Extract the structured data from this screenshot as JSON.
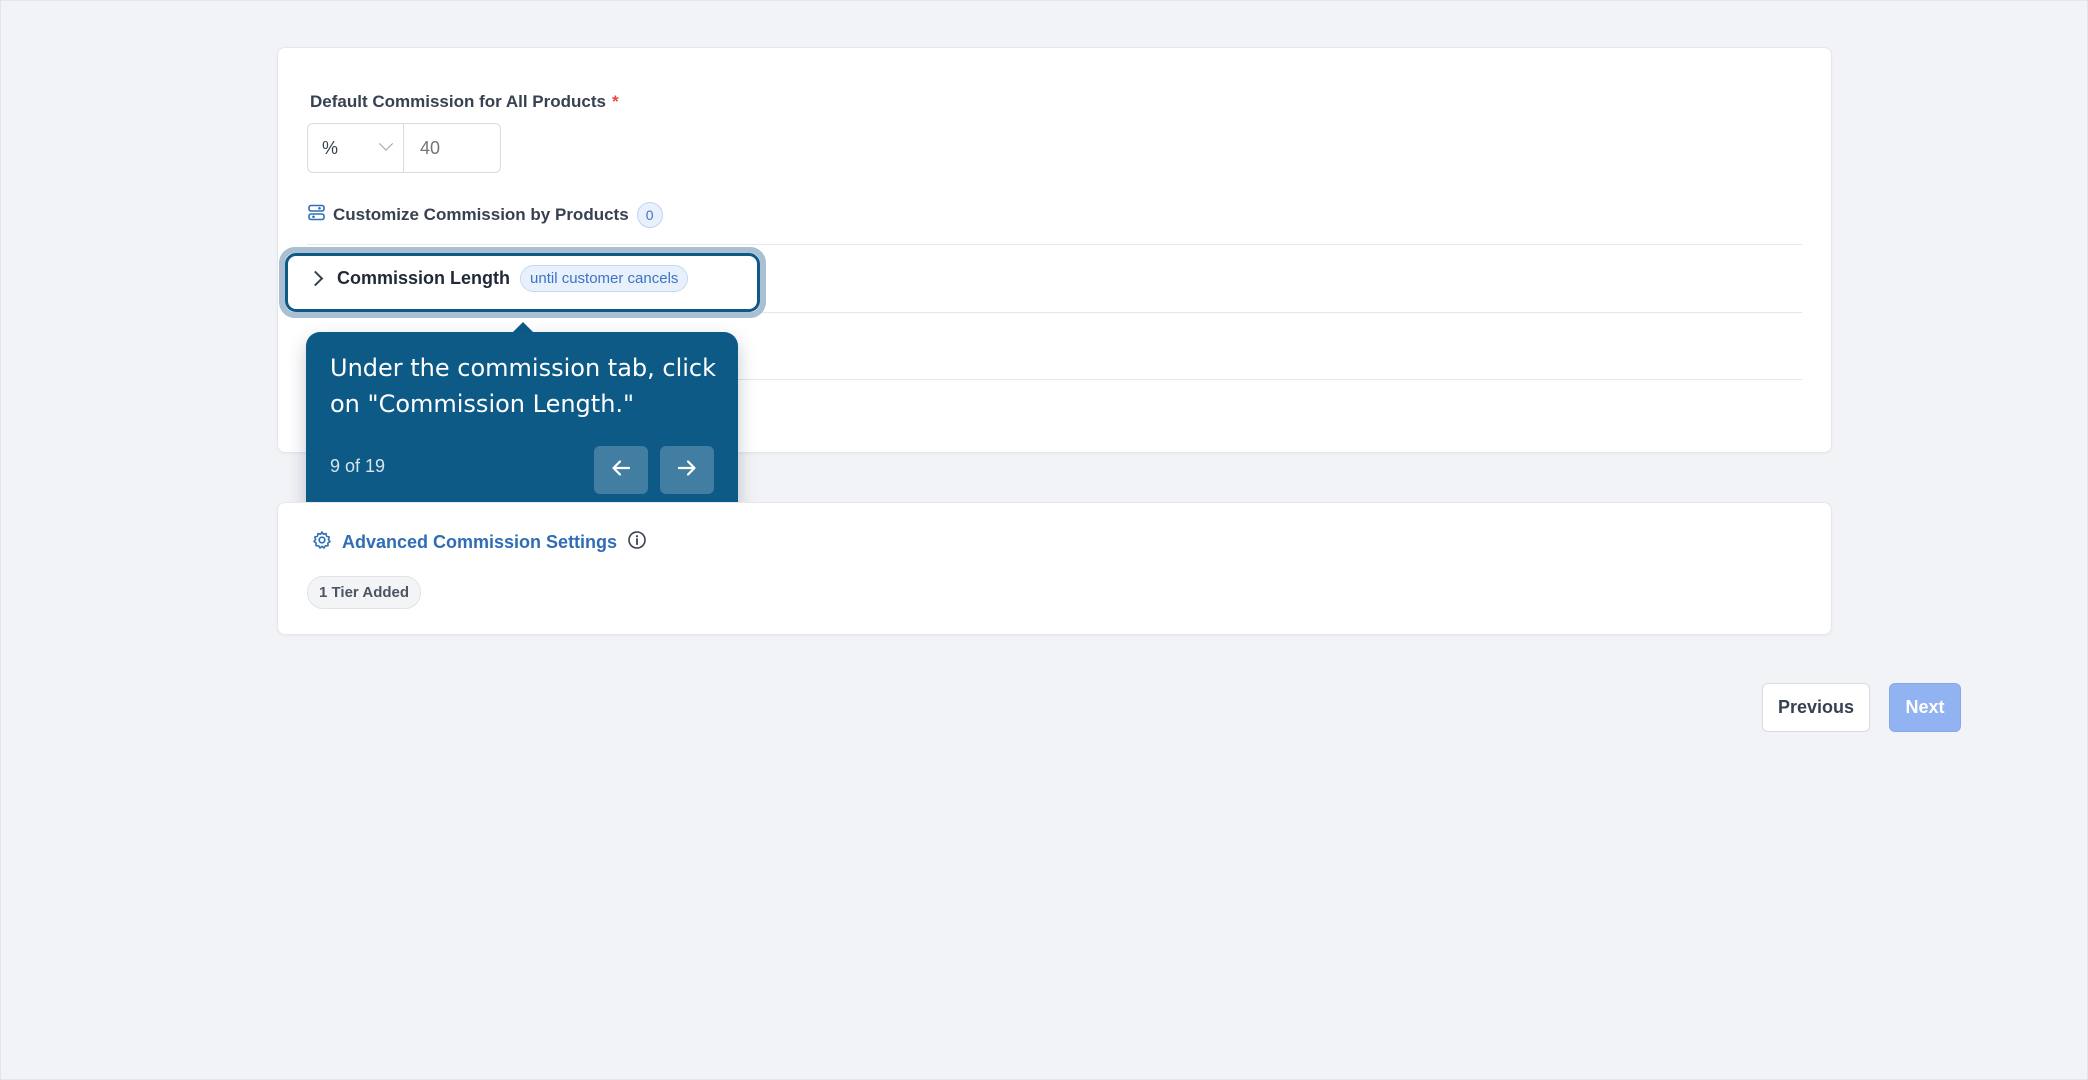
{
  "default_commission": {
    "label": "Default Commission for All Products",
    "required_marker": "*",
    "type_value": "%",
    "amount_placeholder": "40"
  },
  "customize": {
    "label": "Customize Commission by Products",
    "count": "0"
  },
  "commission_length": {
    "label": "Commission Length",
    "badge": "until customer cancels"
  },
  "tooltip": {
    "text": "Under the commission tab, click on \"Commission Length.\"",
    "step": "9 of 19"
  },
  "advanced": {
    "label": "Advanced Commission Settings",
    "tier_badge": "1 Tier Added"
  },
  "footer": {
    "previous_label": "Previous",
    "next_label": "Next"
  },
  "colors": {
    "accent": "#0d5a87",
    "link": "#2f6db5",
    "next_button": "#91b3f2",
    "required": "#ef4444"
  }
}
